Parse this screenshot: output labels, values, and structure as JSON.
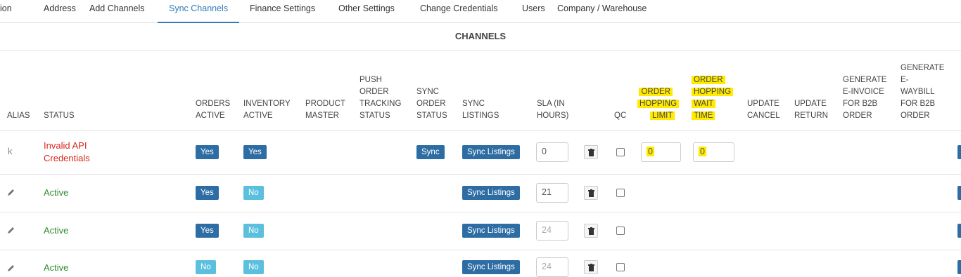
{
  "tabs": [
    {
      "label": "ion"
    },
    {
      "label": "Address"
    },
    {
      "label": "Add Channels"
    },
    {
      "label": "Sync Channels"
    },
    {
      "label": "Finance Settings"
    },
    {
      "label": "Other Settings"
    },
    {
      "label": "Change Credentials"
    },
    {
      "label": "Users"
    },
    {
      "label": "Company / Warehouse"
    }
  ],
  "active_tab": "Sync Channels",
  "section_title": "CHANNELS",
  "headers": {
    "alias": "ALIAS",
    "status": "STATUS",
    "orders_active": "ORDERS\nACTIVE",
    "inventory_active": "INVENTORY\nACTIVE",
    "product_master": "PRODUCT\nMASTER",
    "push_order": "PUSH\nORDER\nTRACKING\nSTATUS",
    "sync_order": "SYNC\nORDER\nSTATUS",
    "sync_listings": "SYNC\nLISTINGS",
    "sla": "SLA (IN\nHOURS)",
    "qc": "QC",
    "hop_limit": [
      "ORDER",
      "HOPPING",
      "LIMIT"
    ],
    "hop_wait": [
      "ORDER",
      "HOPPING",
      "WAIT",
      "TIME"
    ],
    "update_cancel": "UPDATE\nCANCEL",
    "update_return": "UPDATE\nRETURN",
    "einvoice": "GENERATE\nE-INVOICE\nFOR B2B\nORDER",
    "eway": "GENERATE\nE-\nWAYBILL\nFOR B2B\nORDER"
  },
  "rows": [
    {
      "alias": "k",
      "status": "Invalid API\nCredentials",
      "orders": "Yes",
      "inventory": "Yes",
      "sync": "Sync",
      "sync_listings": "Sync Listings",
      "sla": "0",
      "hop_limit": "0",
      "hop_wait": "0"
    },
    {
      "status": "Active",
      "orders": "Yes",
      "inventory": "No",
      "sync_listings": "Sync Listings",
      "sla": "21"
    },
    {
      "status": "Active",
      "orders": "Yes",
      "inventory": "No",
      "sync_listings": "Sync Listings",
      "sla": "24"
    },
    {
      "status": "Active",
      "orders": "No",
      "inventory": "No",
      "sync_listings": "Sync Listings",
      "sla": "24"
    }
  ],
  "colors": {
    "accent": "#337ab7",
    "button_dark": "#2e6da4",
    "button_light": "#5bc0de",
    "error": "#d9261c",
    "ok": "#2e8b2e",
    "highlight": "#ffea00"
  },
  "icons": [
    "pencil-icon",
    "trash-icon",
    "checkbox-icon"
  ]
}
